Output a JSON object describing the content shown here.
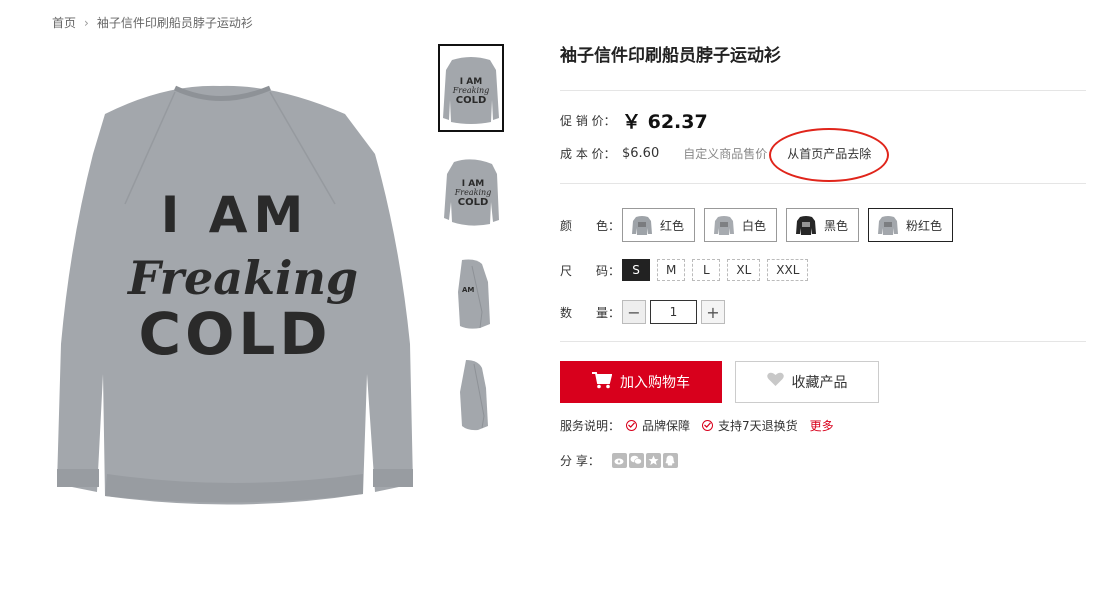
{
  "breadcrumb": {
    "home": "首页",
    "separator": "›",
    "current": "袖子信件印刷船员脖子运动衫"
  },
  "product": {
    "image_text": {
      "line1": "I AM",
      "line2": "Freaking",
      "line3": "COLD"
    },
    "shirt_color": "#a3a7ac",
    "title": "袖子信件印刷船员脖子运动衫",
    "promo_price_label": "促 销 价：",
    "promo_price": "￥ 62.37",
    "cost_price_label": "成 本 价：",
    "cost_price": "$6.60",
    "custom_price_link": "自定义商品售价",
    "remove_link": "从首页产品去除",
    "color_label": "颜　　色：",
    "colors": [
      {
        "label": "红色",
        "swatch": "#9ea3a8",
        "selected": false
      },
      {
        "label": "白色",
        "swatch": "#a7abb0",
        "selected": false
      },
      {
        "label": "黑色",
        "swatch": "#262626",
        "selected": false
      },
      {
        "label": "粉红色",
        "swatch": "#a3a7ac",
        "selected": true
      }
    ],
    "size_label": "尺　　码：",
    "sizes": [
      {
        "label": "S",
        "selected": true
      },
      {
        "label": "M",
        "selected": false
      },
      {
        "label": "L",
        "selected": false
      },
      {
        "label": "XL",
        "selected": false
      },
      {
        "label": "XXL",
        "selected": false
      }
    ],
    "qty_label": "数　　量：",
    "qty_minus": "−",
    "qty_value": "1",
    "qty_plus": "+",
    "add_to_cart": "加入购物车",
    "favorite": "收藏产品",
    "service_label": "服务说明：",
    "services": [
      "品牌保障",
      "支持7天退换货"
    ],
    "more": "更多",
    "share_label": "分 享：",
    "share_icons": [
      "weibo-icon",
      "wechat-icon",
      "star-icon",
      "qq-icon"
    ]
  },
  "colors": {
    "accent": "#d8001c",
    "annotation": "#e0251b"
  }
}
